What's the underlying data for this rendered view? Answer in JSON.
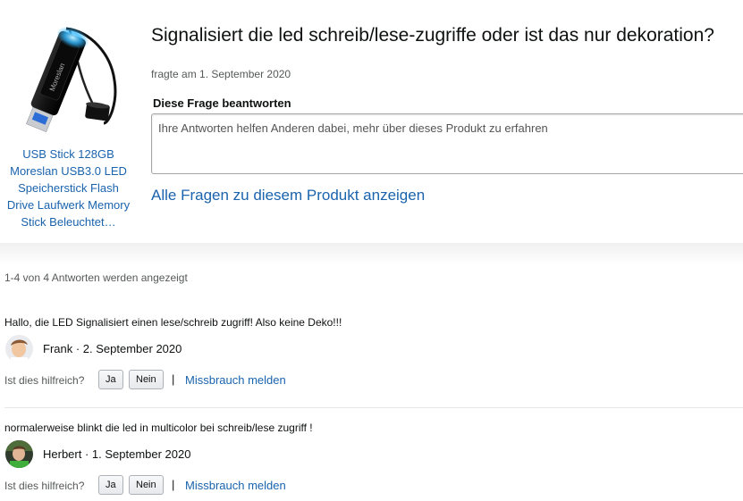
{
  "product": {
    "link_text": "USB Stick 128GB Moreslan USB3.0 LED Speicherstick Flash Drive Laufwerk Memory Stick Beleuchtet…",
    "brand_on_image": "Moreslan"
  },
  "question": {
    "title": "Signalisiert die led schreib/lese-zugriffe oder ist das nur dekoration?",
    "asked_meta": "fragte am 1. September 2020",
    "answer_label": "Diese Frage beantworten",
    "answer_placeholder": "Ihre Antworten helfen Anderen dabei, mehr über dieses Produkt zu erfahren",
    "all_questions_link": "Alle Fragen zu diesem Produkt anzeigen"
  },
  "answers_count": "1-4 von 4 Antworten werden angezeigt",
  "answers": [
    {
      "text": "Hallo, die LED Signalisiert einen lese/schreib zugriff! Also keine Deko!!!",
      "author": "Frank · 2. September 2020",
      "avatar": "user-avatar-frank"
    },
    {
      "text": "normalerweise blinkt die led in multicolor bei schreib/lese zugriff !",
      "author": "Herbert · 1. September 2020",
      "avatar": "user-avatar-herbert"
    }
  ],
  "helpful": {
    "label": "Ist dies hilfreich?",
    "yes": "Ja",
    "no": "Nein",
    "separator": "|",
    "report": "Missbrauch melden"
  },
  "colors": {
    "link": "#1a63ad",
    "text": "#0f1111",
    "muted": "#565959"
  }
}
